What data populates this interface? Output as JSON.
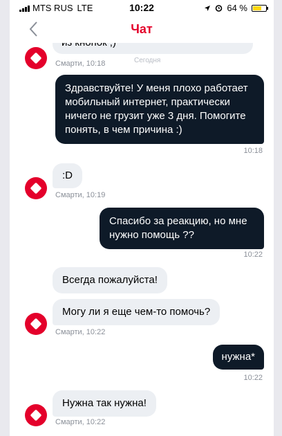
{
  "status_bar": {
    "carrier": "MTS RUS",
    "network": "LTE",
    "time": "10:22",
    "battery": "64 %",
    "battery_level": 0.64
  },
  "nav": {
    "title": "Чат"
  },
  "messages": {
    "partial_text": "из кнопок ;)",
    "meta_1": "Смарти, 10:18",
    "today_label": "Сегодня",
    "msg_out_1": "Здравствуйте! У меня плохо работает мобильный интернет, практически ничего не грузит уже 3 дня. Помогите понять, в чем причина :)",
    "time_out_1": "10:18",
    "msg_in_2": ":D",
    "meta_2": "Смарти, 10:19",
    "msg_out_2": "Спасибо за реакцию, но мне нужно помощь ??",
    "time_out_2": "10:22",
    "msg_in_3": "Всегда пожалуйста!",
    "msg_in_4": "Могу ли я еще чем-то помочь?",
    "meta_4": "Смарти, 10:22",
    "msg_out_3": "нужна*",
    "time_out_3": "10:22",
    "msg_in_5": "Нужна так нужна!",
    "meta_5": "Смарти, 10:22"
  },
  "colors": {
    "brand": "#e4002b",
    "outgoing_bubble": "#0e1a28",
    "incoming_bubble": "#eceff3"
  }
}
